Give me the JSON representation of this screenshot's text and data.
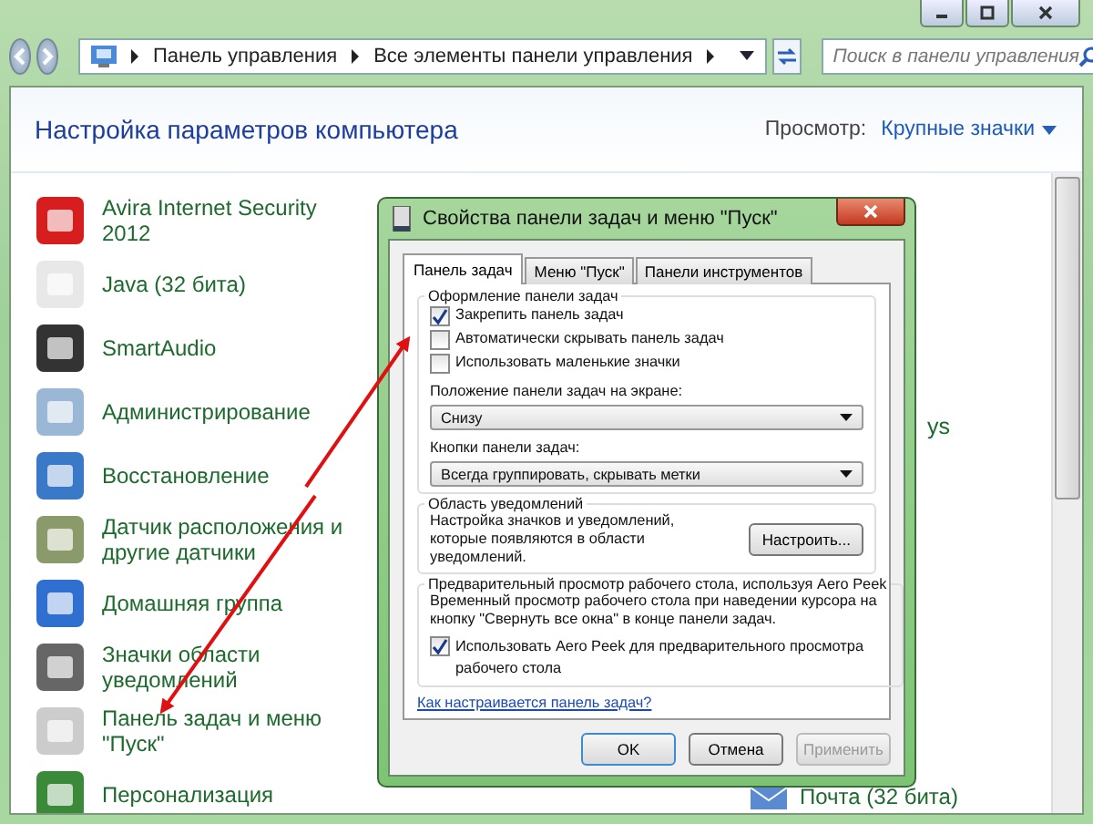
{
  "window": {
    "breadcrumbs": [
      "Панель управления",
      "Все элементы панели управления"
    ],
    "search": {
      "placeholder": "Поиск в панели управления"
    }
  },
  "header": {
    "title": "Настройка параметров компьютера",
    "view_label": "Просмотр:",
    "view_value": "Крупные значки"
  },
  "items": [
    {
      "label": "Avira Internet Security 2012"
    },
    {
      "label": "Java (32 бита)"
    },
    {
      "label": "SmartAudio"
    },
    {
      "label": "Администрирование"
    },
    {
      "label": "Восстановление"
    },
    {
      "label": "Датчик расположения и другие датчики"
    },
    {
      "label": "Домашняя группа"
    },
    {
      "label": "Значки области уведомлений"
    },
    {
      "label": "Панель задач и меню \"Пуск\""
    },
    {
      "label": "Персонализация"
    }
  ],
  "partial_texts": [
    "ys",
    "Почта (32 бита)"
  ],
  "dialog": {
    "title": "Свойства панели задач и меню \"Пуск\"",
    "tabs": [
      {
        "label": "Панель задач",
        "selected": true
      },
      {
        "label": "Меню \"Пуск\"",
        "selected": false
      },
      {
        "label": "Панели инструментов",
        "selected": false
      }
    ],
    "appearance": {
      "legend": "Оформление панели задач",
      "checks": [
        {
          "label": "Закрепить панель задач",
          "checked": true
        },
        {
          "label": "Автоматически скрывать панель задач",
          "checked": false
        },
        {
          "label": "Использовать маленькие значки",
          "checked": false
        }
      ],
      "position_label": "Положение панели задач на экране:",
      "position_value": "Снизу",
      "buttons_label": "Кнопки панели задач:",
      "buttons_value": "Всегда группировать, скрывать метки"
    },
    "notifications": {
      "legend": "Область уведомлений",
      "text": "Настройка значков и уведомлений, которые появляются в области уведомлений.",
      "button": "Настроить..."
    },
    "peek": {
      "legend": "Предварительный просмотр рабочего стола, используя Aero Peek",
      "text": "Временный просмотр рабочего стола при наведении курсора на кнопку \"Свернуть все окна\" в конце панели задач.",
      "check": {
        "label": "Использовать Aero Peek для предварительного просмотра рабочего стола",
        "checked": true
      }
    },
    "help_link": "Как настраивается панель задач?",
    "buttons": [
      {
        "label": "OK",
        "disabled": false
      },
      {
        "label": "Отмена",
        "disabled": false
      },
      {
        "label": "Применить",
        "disabled": true
      }
    ]
  }
}
